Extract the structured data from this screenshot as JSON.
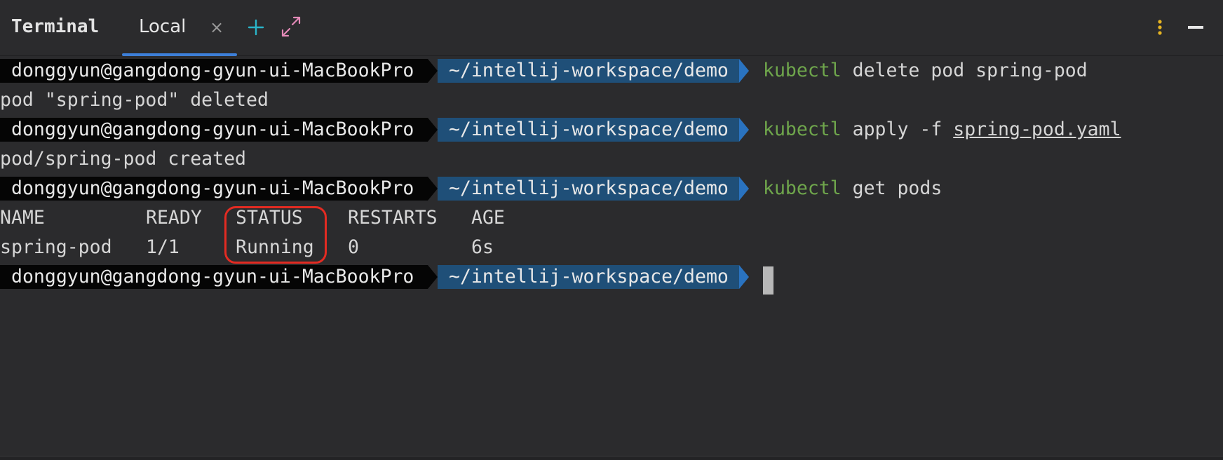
{
  "header": {
    "title": "Terminal",
    "tabs": [
      {
        "label": "Local",
        "close_glyph": "×",
        "active": true
      }
    ],
    "add_icon": "plus-icon",
    "expand_icon": "expand-icon",
    "options_icon": "kebab-menu-icon",
    "minimize_icon": "minimize-icon"
  },
  "colors": {
    "accent_tab": "#3d7fd8",
    "add_icon": "#2ab4c8",
    "expand_icon": "#e48ab8",
    "kebab_icon": "#e6b422",
    "prompt_user_bg": "#050505",
    "prompt_path_bg": "#1f4f78",
    "command_keyword": "#6fa64c",
    "highlight": "#e32b22"
  },
  "prompt": {
    "user": "donggyun@gangdong-gyun-ui-MacBookPro",
    "path": "~/intellij-workspace/demo"
  },
  "session": [
    {
      "type": "command",
      "keyword": "kubectl",
      "args": " delete pod spring-pod",
      "file": ""
    },
    {
      "type": "output",
      "text": "pod \"spring-pod\" deleted"
    },
    {
      "type": "command",
      "keyword": "kubectl",
      "args": " apply -f ",
      "file": "spring-pod.yaml"
    },
    {
      "type": "output",
      "text": "pod/spring-pod created"
    },
    {
      "type": "command",
      "keyword": "kubectl",
      "args": " get pods",
      "file": ""
    }
  ],
  "pods_table": {
    "headers": [
      "NAME",
      "READY",
      "STATUS",
      "RESTARTS",
      "AGE"
    ],
    "rows": [
      [
        "spring-pod",
        "1/1",
        "Running",
        "0",
        "6s"
      ]
    ],
    "highlighted_column": "STATUS"
  }
}
